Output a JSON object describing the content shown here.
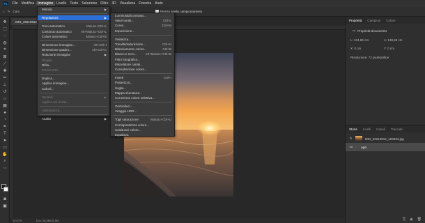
{
  "menubar": {
    "app_icon": "Ps",
    "items": [
      "File",
      "Modifica",
      "Immagine",
      "Livello",
      "Testo",
      "Selezione",
      "Filtro",
      "3D",
      "Visualizza",
      "Finestra",
      "Aiuto"
    ]
  },
  "options_bar": {
    "label": "Cam",
    "checkbox_label": "Mostra anello campionamento"
  },
  "document": {
    "tab_title": "IMG_20210812_...",
    "status_zoom": "16,67%",
    "status_info": "Doc: 28,5M/28,5M"
  },
  "image_menu": {
    "items": [
      {
        "label": "Metodo",
        "shortcut": "",
        "submenu": true,
        "state": "normal"
      },
      {
        "sep": true
      },
      {
        "label": "Regolazioni",
        "shortcut": "",
        "submenu": true,
        "state": "highlighted"
      },
      {
        "sep": true
      },
      {
        "label": "Tono automatico",
        "shortcut": "Maiusc+Ctrl+L",
        "state": "normal"
      },
      {
        "label": "Contrasto automatico",
        "shortcut": "Alt+Maiusc+Ctrl+L",
        "state": "normal"
      },
      {
        "label": "Colore automatico",
        "shortcut": "Maiusc+Ctrl+B",
        "state": "normal"
      },
      {
        "sep": true
      },
      {
        "label": "Dimensione immagine...",
        "shortcut": "Alt+Ctrl+I",
        "state": "normal"
      },
      {
        "label": "Dimensione quadro...",
        "shortcut": "Alt+Ctrl+C",
        "state": "normal"
      },
      {
        "label": "Rotazione immagine",
        "shortcut": "",
        "submenu": true,
        "state": "normal"
      },
      {
        "label": "Ritaglia",
        "shortcut": "",
        "state": "disabled"
      },
      {
        "label": "Rifila...",
        "shortcut": "",
        "state": "normal"
      },
      {
        "label": "Mostra tutto",
        "shortcut": "",
        "state": "disabled"
      },
      {
        "sep": true
      },
      {
        "label": "Duplica...",
        "shortcut": "",
        "state": "normal"
      },
      {
        "label": "Applica immagine...",
        "shortcut": "",
        "state": "normal"
      },
      {
        "label": "Calcoli...",
        "shortcut": "",
        "state": "normal"
      },
      {
        "sep": true
      },
      {
        "label": "Variabili",
        "shortcut": "",
        "submenu": true,
        "state": "disabled"
      },
      {
        "label": "Applica set di dati...",
        "shortcut": "",
        "state": "disabled"
      },
      {
        "sep": true
      },
      {
        "label": "Abbondanza...",
        "shortcut": "",
        "state": "disabled"
      },
      {
        "sep": true
      },
      {
        "label": "Analisi",
        "shortcut": "",
        "submenu": true,
        "state": "normal"
      }
    ]
  },
  "adjustments_menu": {
    "items": [
      {
        "label": "Luminosità/contrasto...",
        "shortcut": ""
      },
      {
        "label": "Valori tonali...",
        "shortcut": "Ctrl+L"
      },
      {
        "label": "Curve...",
        "shortcut": "Ctrl+M"
      },
      {
        "label": "Esposizione...",
        "shortcut": ""
      },
      {
        "sep": true
      },
      {
        "label": "Vividezza...",
        "shortcut": ""
      },
      {
        "label": "Tonalità/saturazione...",
        "shortcut": "Ctrl+U"
      },
      {
        "label": "Bilanciamento colore...",
        "shortcut": "Ctrl+B"
      },
      {
        "label": "Bianco e nero...",
        "shortcut": "Alt+Maiusc+Ctrl+B"
      },
      {
        "label": "Filtro fotografico...",
        "shortcut": ""
      },
      {
        "label": "Miscelatore canali...",
        "shortcut": ""
      },
      {
        "label": "Consultazione colore...",
        "shortcut": ""
      },
      {
        "sep": true
      },
      {
        "label": "Inverti",
        "shortcut": "Ctrl+I"
      },
      {
        "label": "Posterizza...",
        "shortcut": ""
      },
      {
        "label": "Soglia...",
        "shortcut": ""
      },
      {
        "label": "Mappa sfumatura...",
        "shortcut": ""
      },
      {
        "label": "Correzione colore selettiva...",
        "shortcut": ""
      },
      {
        "sep": true
      },
      {
        "label": "Ombre/luci...",
        "shortcut": ""
      },
      {
        "label": "Viraggio HDR...",
        "shortcut": ""
      },
      {
        "sep": true
      },
      {
        "label": "Togli saturazione",
        "shortcut": "Maiusc+Ctrl+U"
      },
      {
        "label": "Corrispondenza colore...",
        "shortcut": ""
      },
      {
        "label": "Sostituisci colore...",
        "shortcut": ""
      },
      {
        "label": "Equalizza",
        "shortcut": ""
      }
    ]
  },
  "properties_panel": {
    "tabs": [
      "Proprietà",
      "Campioni",
      "Colore"
    ],
    "title": "Proprietà documento",
    "width_label": "L:",
    "width_value": "104,86 cm",
    "height_label": "A:",
    "height_value": "139,86 cm",
    "x_label": "X:",
    "x_value": "0 cm",
    "y_label": "Y:",
    "y_value": "0 cm",
    "resolution": "Risoluzione: 72 pixel/pollice"
  },
  "history_panel": {
    "tabs": [
      "Storia",
      "Livelli",
      "Canali",
      "Tracciati"
    ],
    "snapshot_label": "IMG_20210812_194923.jpg",
    "step_label": "Apri"
  }
}
